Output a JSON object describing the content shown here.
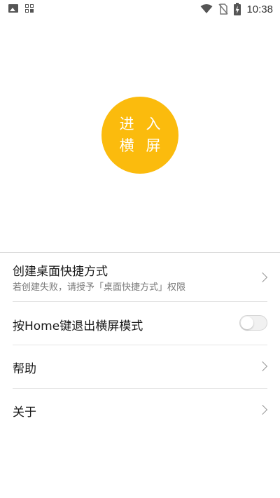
{
  "status_bar": {
    "time": "10:38",
    "left_icons": [
      "image-icon",
      "qr-grid-icon"
    ],
    "right_icons": [
      "wifi-icon",
      "no-sim-icon",
      "battery-charging-icon"
    ]
  },
  "enter_button": {
    "line1": "进 入",
    "line2": "横 屏",
    "color": "#fbbb0d"
  },
  "settings": {
    "shortcut": {
      "title": "创建桌面快捷方式",
      "subtitle": "若创建失败，请授予「桌面快捷方式」权限"
    },
    "home_exit": {
      "title": "按Home键退出横屏模式",
      "enabled": false
    },
    "help": {
      "title": "帮助"
    },
    "about": {
      "title": "关于"
    }
  }
}
